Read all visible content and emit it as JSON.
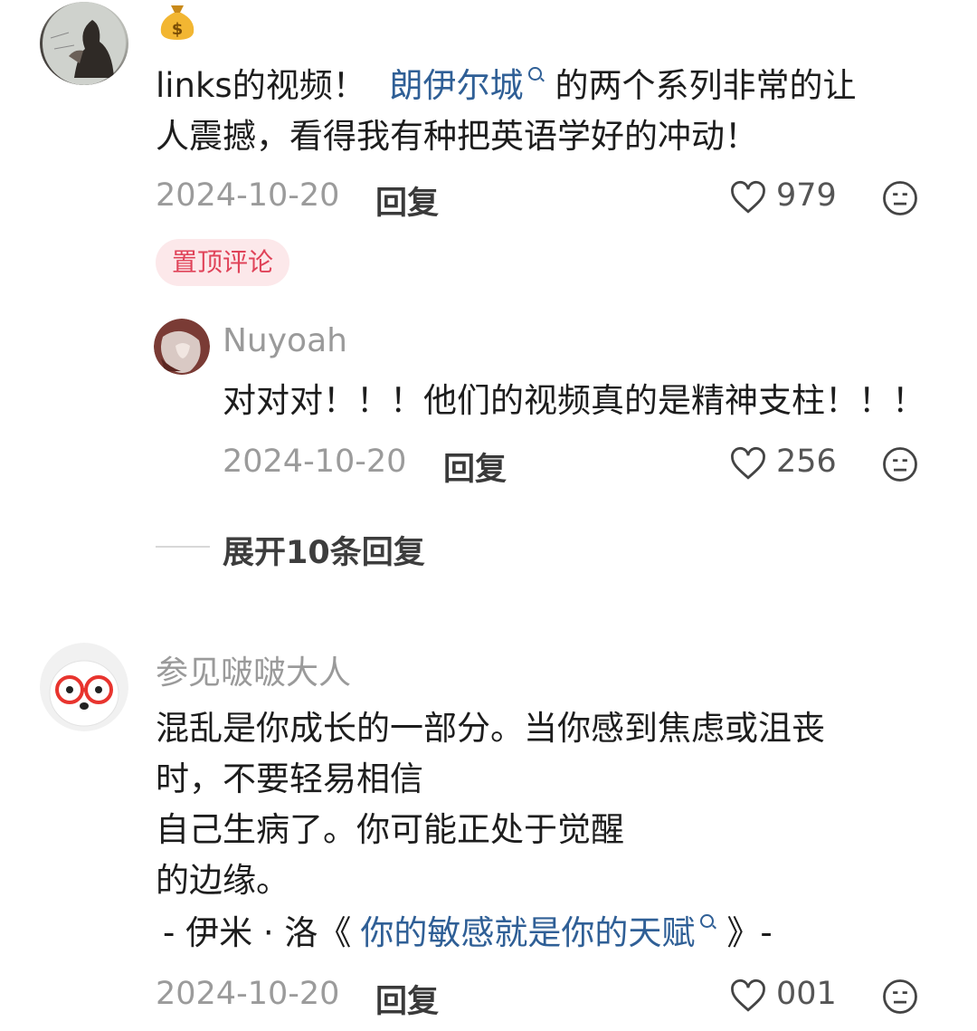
{
  "comments": [
    {
      "text_parts": [
        "links的视频！",
        "朗伊尔城",
        "的两个系列非常的让"
      ],
      "line2": "人震撼，看得我有种把英语学好的冲动！",
      "date": "2024-10-20",
      "reply_label": "回复",
      "likes": "979",
      "badge": "置顶评论",
      "sub_reply": {
        "username": "Nuyoah",
        "text": "对对对！！！他们的视频真的是精神支柱！！！",
        "date": "2024-10-20",
        "reply_label": "回复",
        "likes": "256"
      },
      "expand_label": "展开10条回复"
    },
    {
      "username": "参见啵啵大人",
      "lines": [
        "混乱是你成长的一部分。当你感到焦虑或沮丧",
        "时，不要轻易相信",
        "自己生病了。你可能正处于觉醒",
        "的边缘。"
      ],
      "quote_prefix": "- 伊米 · 洛《",
      "quote_link": "你的敏感就是你的天赋",
      "quote_suffix": "》-",
      "date": "2024-10-20",
      "reply_label": "回复",
      "likes": "001"
    }
  ],
  "icons": {
    "heart": "heart-icon",
    "dislike": "dislike-face-icon",
    "search": "search-icon",
    "money": "money-bag-emoji"
  },
  "colors": {
    "link": "#2f5f96",
    "badge_bg": "#fce8ea",
    "badge_text": "#e04359"
  }
}
